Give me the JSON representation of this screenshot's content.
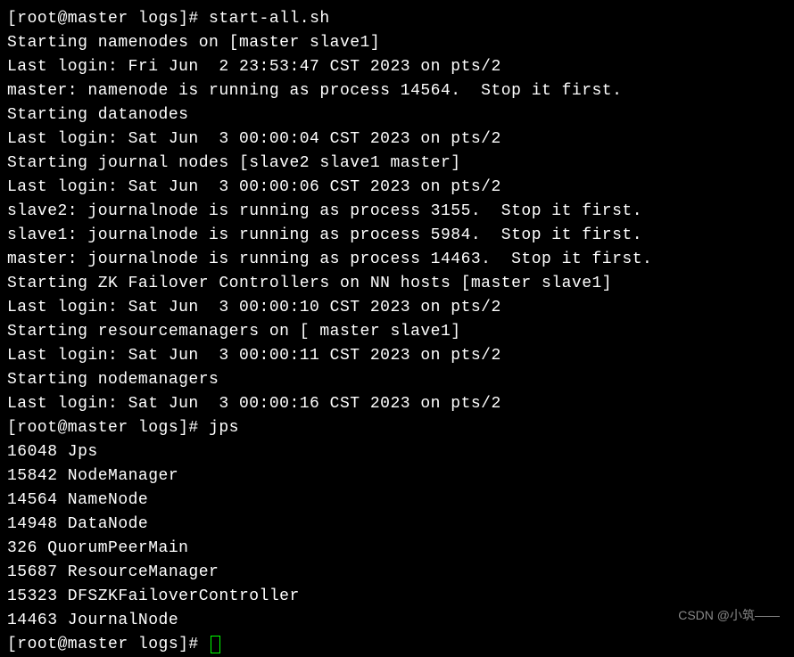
{
  "terminal": {
    "lines": [
      {
        "prompt": "[root@master logs]# ",
        "command": "start-all.sh"
      },
      {
        "text": "Starting namenodes on [master slave1]"
      },
      {
        "text": "Last login: Fri Jun  2 23:53:47 CST 2023 on pts/2"
      },
      {
        "text": "master: namenode is running as process 14564.  Stop it first."
      },
      {
        "text": "Starting datanodes"
      },
      {
        "text": "Last login: Sat Jun  3 00:00:04 CST 2023 on pts/2"
      },
      {
        "text": "Starting journal nodes [slave2 slave1 master]"
      },
      {
        "text": "Last login: Sat Jun  3 00:00:06 CST 2023 on pts/2"
      },
      {
        "text": "slave2: journalnode is running as process 3155.  Stop it first."
      },
      {
        "text": "slave1: journalnode is running as process 5984.  Stop it first."
      },
      {
        "text": "master: journalnode is running as process 14463.  Stop it first."
      },
      {
        "text": "Starting ZK Failover Controllers on NN hosts [master slave1]"
      },
      {
        "text": "Last login: Sat Jun  3 00:00:10 CST 2023 on pts/2"
      },
      {
        "text": "Starting resourcemanagers on [ master slave1]"
      },
      {
        "text": "Last login: Sat Jun  3 00:00:11 CST 2023 on pts/2"
      },
      {
        "text": "Starting nodemanagers"
      },
      {
        "text": "Last login: Sat Jun  3 00:00:16 CST 2023 on pts/2"
      },
      {
        "prompt": "[root@master logs]# ",
        "command": "jps"
      },
      {
        "text": "16048 Jps"
      },
      {
        "text": "15842 NodeManager"
      },
      {
        "text": "14564 NameNode"
      },
      {
        "text": "14948 DataNode"
      },
      {
        "text": "326 QuorumPeerMain"
      },
      {
        "text": "15687 ResourceManager"
      },
      {
        "text": "15323 DFSZKFailoverController"
      },
      {
        "text": "14463 JournalNode"
      },
      {
        "prompt": "[root@master logs]# ",
        "cursor": true
      }
    ]
  },
  "watermark": "CSDN @小筑——"
}
